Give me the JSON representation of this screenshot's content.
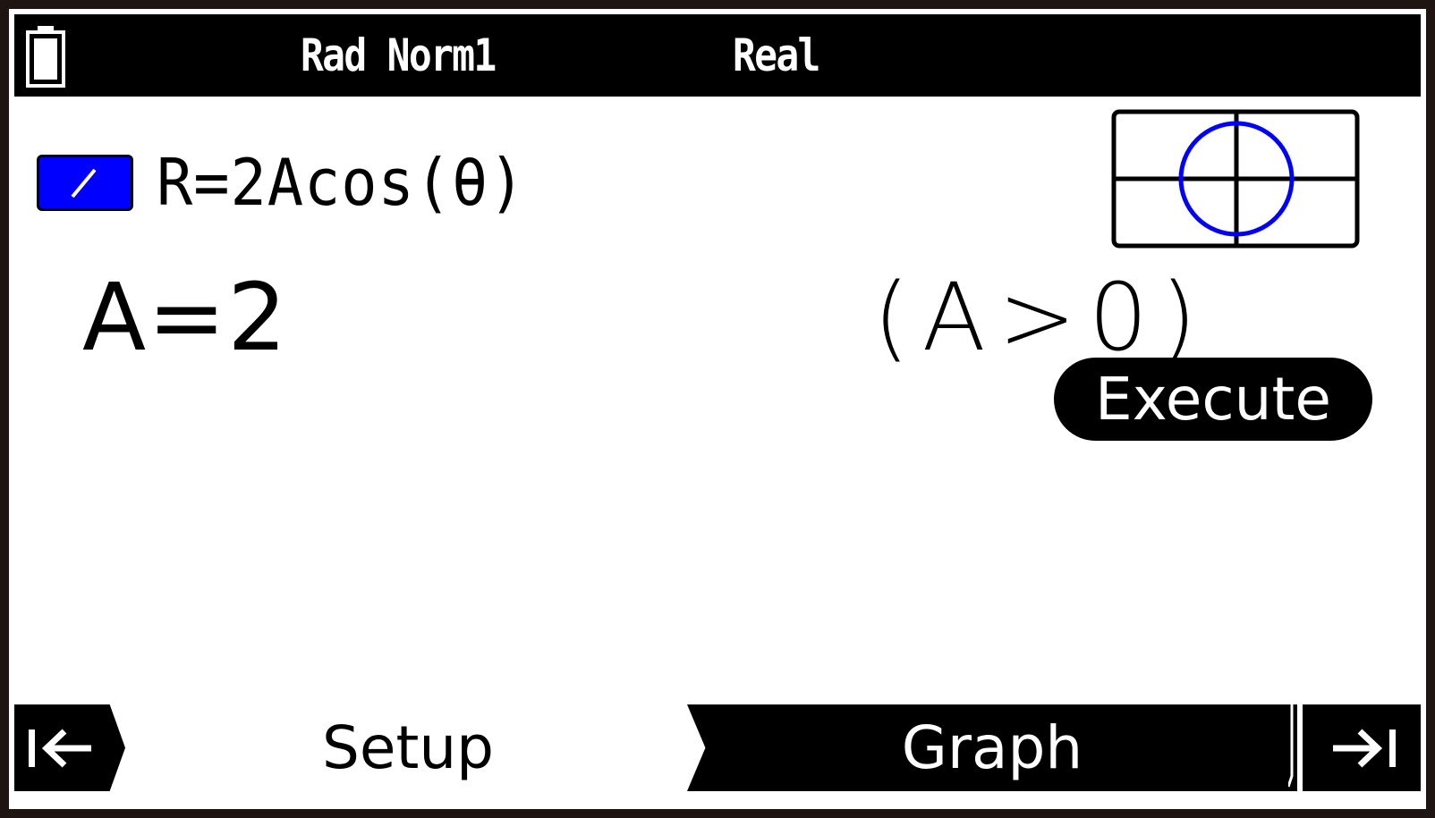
{
  "status_bar": {
    "battery_icon": "battery-icon",
    "angle_mode": "Rad Norm1",
    "complex_mode": "Real"
  },
  "function": {
    "checkbox_icon": "checkbox-check-icon",
    "checked": true,
    "expression": "R=2Acos(θ)",
    "color": "#0000ff"
  },
  "preview": {
    "icon": "polar-circle-preview-icon",
    "curve_color": "#0000ff"
  },
  "parameter": {
    "value": "A=2",
    "condition": "(A>0)"
  },
  "execute_label": "Execute",
  "softkeys": {
    "prev_icon": "prev-page-arrow-icon",
    "setup_label": "Setup",
    "graph_label": "Graph",
    "next_icon": "next-page-arrow-icon"
  }
}
